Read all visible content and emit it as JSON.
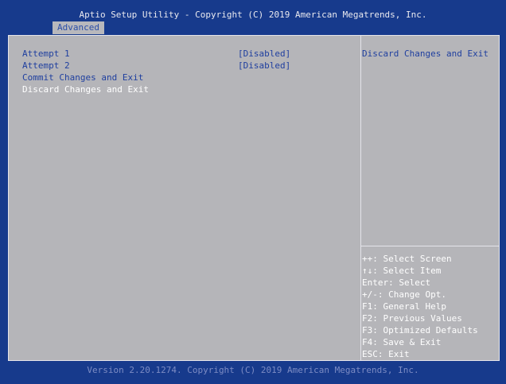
{
  "header": {
    "title": "Aptio Setup Utility - Copyright (C) 2019 American Megatrends, Inc.",
    "tab": "Advanced"
  },
  "menu": {
    "items": [
      {
        "label": "Attempt 1",
        "value": "[Disabled]"
      },
      {
        "label": "Attempt 2",
        "value": "[Disabled]"
      },
      {
        "label": "Commit Changes and Exit"
      },
      {
        "label": "Discard Changes and Exit"
      }
    ],
    "selected_index": 3
  },
  "help": {
    "text": "Discard Changes and Exit"
  },
  "keys": [
    "++: Select Screen",
    "↑↓: Select Item",
    "Enter: Select",
    "+/-: Change Opt.",
    "F1: General Help",
    "F2: Previous Values",
    "F3: Optimized Defaults",
    "F4: Save & Exit",
    "ESC: Exit"
  ],
  "footer": {
    "text": "Version 2.20.1274. Copyright (C) 2019 American Megatrends, Inc."
  },
  "colors": {
    "background": "#173a8c",
    "panel": "#b5b5b9",
    "value_text": "#1f3f9f",
    "highlight_text": "#ffffff"
  }
}
